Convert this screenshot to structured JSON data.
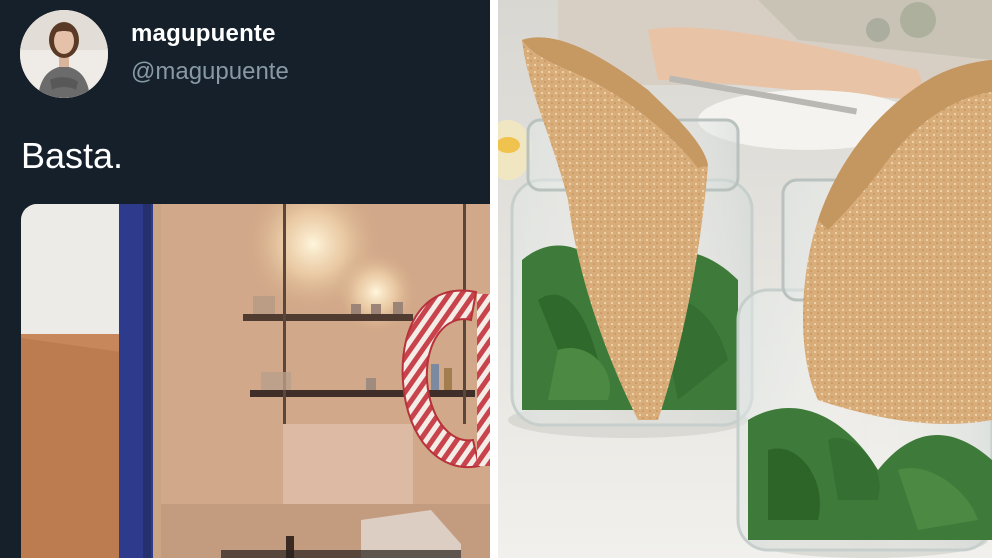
{
  "tweet": {
    "display_name": "magupuente",
    "handle": "@magupuente",
    "text": "Basta.",
    "avatar_icon": "profile-photo",
    "colors": {
      "background": "#15202b",
      "name": "#ffffff",
      "handle": "#8899a6",
      "text": "#ffffff"
    }
  },
  "media": {
    "storefront_sign_text": "C",
    "icon": "storefront-photo"
  },
  "photo": {
    "icon": "empanadas-in-jars-photo"
  }
}
